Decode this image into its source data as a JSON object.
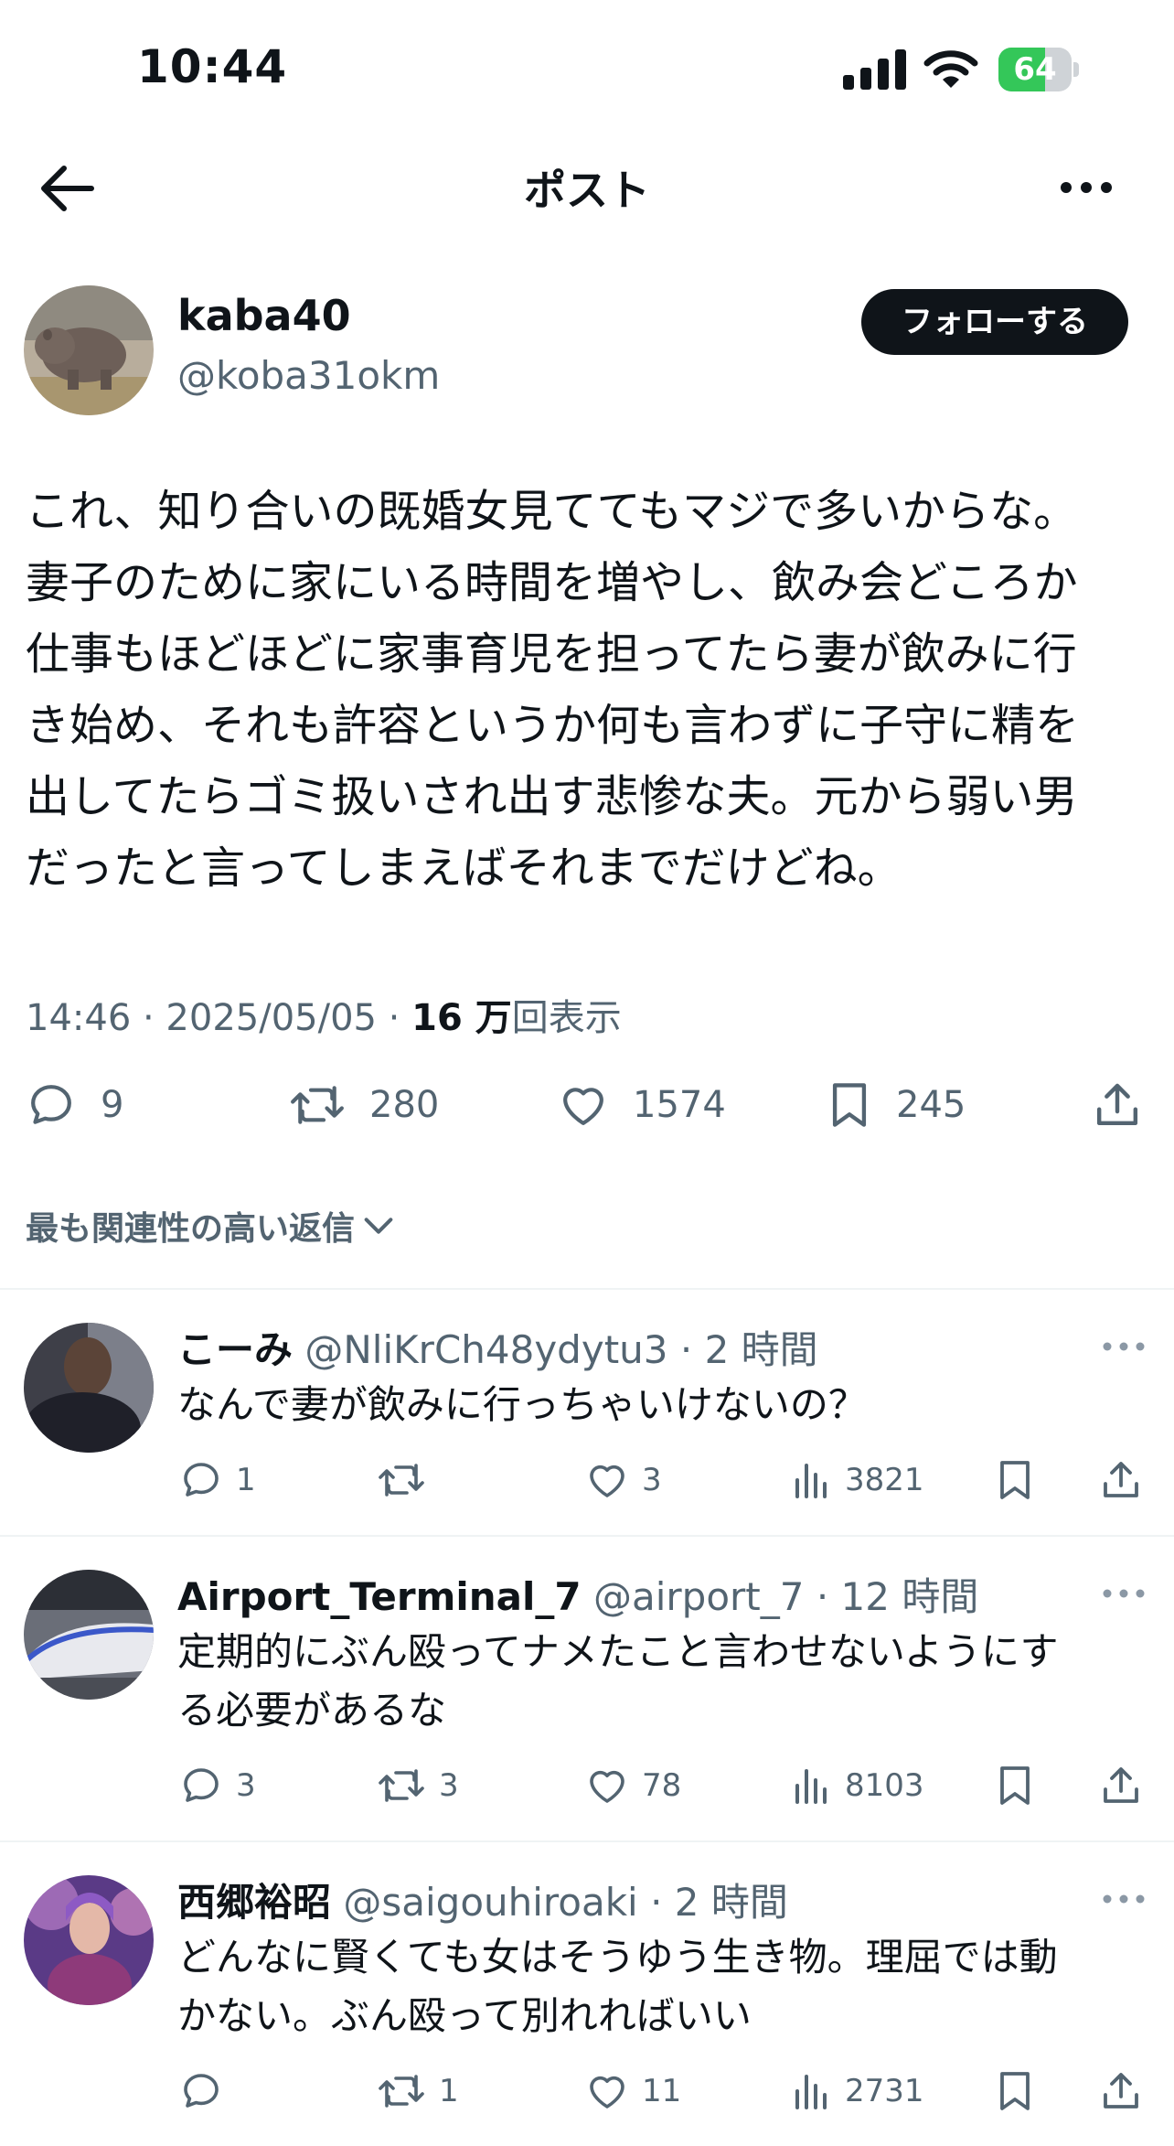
{
  "status_bar": {
    "time": "10:44",
    "battery": "64",
    "battery_level": 0.64
  },
  "header": {
    "title": "ポスト"
  },
  "post": {
    "author_name": "kaba40",
    "author_handle": "@koba31okm",
    "follow_label": "フォローする",
    "lines": [
      "これ、知り合いの既婚女見ててもマジで多いからな。",
      "妻子のために家にいる時間を増やし、飲み会どころか",
      "仕事もほどほどに家事育児を担ってたら妻が飲みに行",
      "き始め、それも許容というか何も言わずに子守に精を",
      "出してたらゴミ扱いされ出す悲惨な夫。元から弱い男",
      "だったと言ってしまえばそれまでだけどね。"
    ],
    "timestamp": "14:46 · 2025/05/05 · ",
    "views_number": "16 万",
    "views_label": "回表示",
    "replies": "9",
    "reposts": "280",
    "likes": "1574",
    "bookmarks": "245"
  },
  "replies_filter": {
    "label": "最も関連性の高い返信"
  },
  "replies": [
    {
      "name": "こーみ",
      "handle": "@NliKrCh48ydytu3",
      "time": "· 2 時間",
      "lines": [
        "なんで妻が飲みに行っちゃいけないの？"
      ],
      "replies": "1",
      "reposts": "",
      "likes": "3",
      "views": "3821"
    },
    {
      "name": "Airport_Terminal_7",
      "handle": "@airport_7",
      "time": "· 12 時間",
      "lines": [
        "定期的にぶん殴ってナメたこと言わせないようにす",
        "る必要があるな"
      ],
      "replies": "3",
      "reposts": "3",
      "likes": "78",
      "views": "8103"
    },
    {
      "name": "西郷裕昭",
      "handle": "@saigouhiroaki",
      "time": "· 2 時間",
      "lines": [
        "どんなに賢くても女はそうゆう生き物。理屈では動",
        "かない。ぶん殴って別れればいい"
      ],
      "replies": "",
      "reposts": "1",
      "likes": "11",
      "views": "2731"
    }
  ]
}
